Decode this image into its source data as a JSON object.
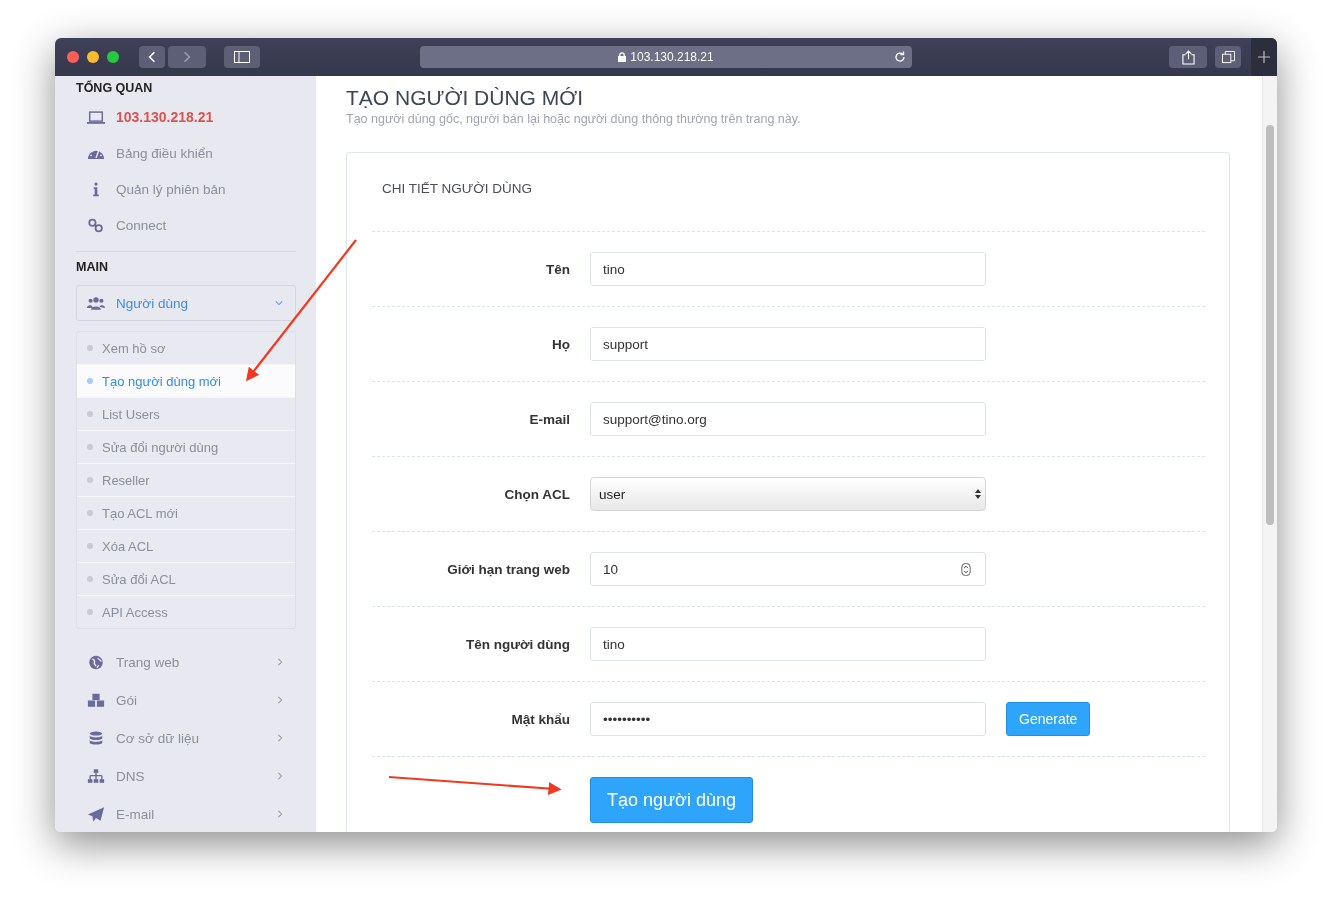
{
  "browser": {
    "address": "103.130.218.21"
  },
  "sidebar": {
    "sections": [
      {
        "heading": "TỔNG QUAN",
        "items": [
          {
            "label": "103.130.218.21",
            "kind": "host"
          },
          {
            "label": "Bảng điều khiển",
            "kind": "link"
          },
          {
            "label": "Quản lý phiên bản",
            "kind": "link"
          },
          {
            "label": "Connect",
            "kind": "link"
          }
        ]
      },
      {
        "heading": "MAIN",
        "items": [
          {
            "label": "Người dùng",
            "kind": "group",
            "expanded": true,
            "children": [
              {
                "label": "Xem hồ sơ",
                "selected": false
              },
              {
                "label": "Tạo người dùng mới",
                "selected": true
              },
              {
                "label": "List Users",
                "selected": false
              },
              {
                "label": "Sửa đổi người dùng",
                "selected": false
              },
              {
                "label": "Reseller",
                "selected": false
              },
              {
                "label": "Tạo ACL mới",
                "selected": false
              },
              {
                "label": "Xóa ACL",
                "selected": false
              },
              {
                "label": "Sửa đổi ACL",
                "selected": false
              },
              {
                "label": "API Access",
                "selected": false
              }
            ]
          },
          {
            "label": "Trang web",
            "kind": "menu",
            "expanded": false
          },
          {
            "label": "Gói",
            "kind": "menu",
            "expanded": false
          },
          {
            "label": "Cơ sở dữ liệu",
            "kind": "menu",
            "expanded": false
          },
          {
            "label": "DNS",
            "kind": "menu",
            "expanded": false
          },
          {
            "label": "E-mail",
            "kind": "menu",
            "expanded": false
          }
        ]
      }
    ]
  },
  "page": {
    "title": "TẠO NGƯỜI DÙNG MỚI",
    "subtitle": "Tạo người dùng gốc, người bán lại hoặc người dùng thông thường trên trang này."
  },
  "card": {
    "heading": "CHI TIẾT NGƯỜI DÙNG",
    "fields": [
      {
        "label": "Tên",
        "kind": "text",
        "value": "tino"
      },
      {
        "label": "Họ",
        "kind": "text",
        "value": "support"
      },
      {
        "label": "E-mail",
        "kind": "text",
        "value": "support@tino.org"
      },
      {
        "label": "Chọn ACL",
        "kind": "select",
        "value": "user"
      },
      {
        "label": "Giới hạn trang web",
        "kind": "number",
        "value": "10"
      },
      {
        "label": "Tên người dùng",
        "kind": "text",
        "value": "tino"
      },
      {
        "label": "Mật khẩu",
        "kind": "password",
        "value": "••••••••••",
        "button": "Generate"
      }
    ],
    "submit": "Tạo người dùng"
  }
}
